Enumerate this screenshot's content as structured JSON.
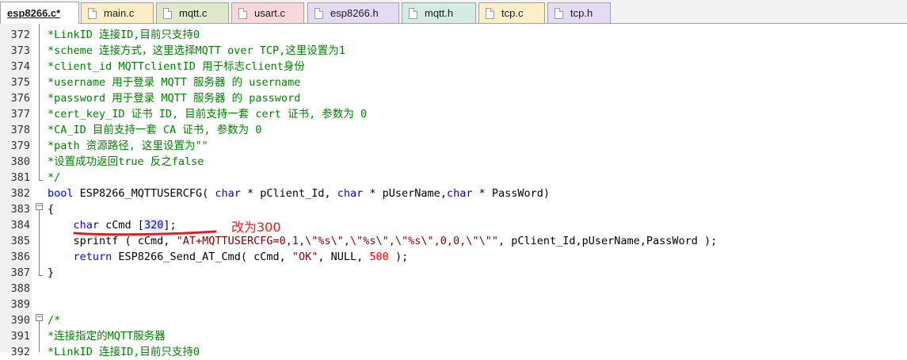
{
  "tabs": [
    {
      "label": "esp8266.c*",
      "active": true,
      "color": "#ffffff"
    },
    {
      "label": "main.c",
      "active": false,
      "color": "#fdeec8"
    },
    {
      "label": "mqtt.c",
      "active": false,
      "color": "#dfe8c8"
    },
    {
      "label": "usart.c",
      "active": false,
      "color": "#f8d8dc"
    },
    {
      "label": "esp8266.h",
      "active": false,
      "color": "#e4dcf4"
    },
    {
      "label": "mqtt.h",
      "active": false,
      "color": "#d4ece4"
    },
    {
      "label": "tcp.c",
      "active": false,
      "color": "#fdeec8"
    },
    {
      "label": "tcp.h",
      "active": false,
      "color": "#e4dcf4"
    }
  ],
  "lines": [
    {
      "no": "372",
      "t": [
        [
          "c",
          "*LinkID 连接ID,目前只支持0"
        ]
      ]
    },
    {
      "no": "373",
      "t": [
        [
          "c",
          "*scheme 连接方式，这里选择MQTT over TCP,这里设置为1"
        ]
      ]
    },
    {
      "no": "374",
      "t": [
        [
          "c",
          "*client_id MQTTclientID 用于标志client身份"
        ]
      ]
    },
    {
      "no": "375",
      "t": [
        [
          "c",
          "*username 用于登录 MQTT 服务器 的 username"
        ]
      ]
    },
    {
      "no": "376",
      "t": [
        [
          "c",
          "*password 用于登录 MQTT 服务器 的 password"
        ]
      ]
    },
    {
      "no": "377",
      "t": [
        [
          "c",
          "*cert_key_ID 证书 ID, 目前支持一套 cert 证书, 参数为 0"
        ]
      ]
    },
    {
      "no": "378",
      "t": [
        [
          "c",
          "*CA_ID 目前支持一套 CA 证书, 参数为 0"
        ]
      ]
    },
    {
      "no": "379",
      "t": [
        [
          "c",
          "*path 资源路径, 这里设置为\"\""
        ]
      ]
    },
    {
      "no": "380",
      "t": [
        [
          "c",
          "*设置成功返回true 反之false"
        ]
      ]
    },
    {
      "no": "381",
      "t": [
        [
          "c",
          "*/"
        ]
      ]
    },
    {
      "no": "382",
      "t": [
        [
          "k",
          "bool"
        ],
        [
          "p",
          " ESP8266_MQTTUSERCFG( "
        ],
        [
          "k",
          "char"
        ],
        [
          "p",
          " * pClient_Id, "
        ],
        [
          "k",
          "char"
        ],
        [
          "p",
          " * pUserName,"
        ],
        [
          "k",
          "char"
        ],
        [
          "p",
          " * PassWord)"
        ]
      ]
    },
    {
      "no": "383",
      "t": [
        [
          "p",
          "{"
        ]
      ]
    },
    {
      "no": "384",
      "t": [
        [
          "p",
          "    "
        ],
        [
          "k",
          "char"
        ],
        [
          "p",
          " cCmd ["
        ],
        [
          "hl",
          "320"
        ],
        [
          "p",
          "];"
        ]
      ]
    },
    {
      "no": "385",
      "t": [
        [
          "p",
          "    sprintf ( cCmd, "
        ],
        [
          "s",
          "\"AT+MQTTUSERCFG=0,1,\\\"%s\\\",\\\"%s\\\",\\\"%s\\\",0,0,\\\"\\\"\""
        ],
        [
          "p",
          ", pClient_Id,pUserName,PassWord );"
        ]
      ]
    },
    {
      "no": "386",
      "t": [
        [
          "p",
          "    "
        ],
        [
          "k",
          "return"
        ],
        [
          "p",
          " ESP8266_Send_AT_Cmd( cCmd, "
        ],
        [
          "s",
          "\"OK\""
        ],
        [
          "p",
          ", NULL, "
        ],
        [
          "n",
          "500"
        ],
        [
          "p",
          " );"
        ]
      ]
    },
    {
      "no": "387",
      "t": [
        [
          "p",
          "}"
        ]
      ]
    },
    {
      "no": "388",
      "t": []
    },
    {
      "no": "389",
      "t": []
    },
    {
      "no": "390",
      "t": [
        [
          "c",
          "/*"
        ]
      ]
    },
    {
      "no": "391",
      "t": [
        [
          "c",
          "*连接指定的MQTT服务器"
        ]
      ]
    },
    {
      "no": "392",
      "t": [
        [
          "c",
          "*LinkID 连接ID,目前只支持0"
        ]
      ]
    }
  ],
  "annotation": {
    "text": "改为300",
    "color": "#e02020"
  },
  "colors": {
    "comment": "#008000",
    "keyword": "#0000ff",
    "string": "#800000",
    "number": "#ff0000"
  },
  "icons": {
    "tab_file": "file-icon",
    "fold_minus": "fold-collapse-icon"
  }
}
